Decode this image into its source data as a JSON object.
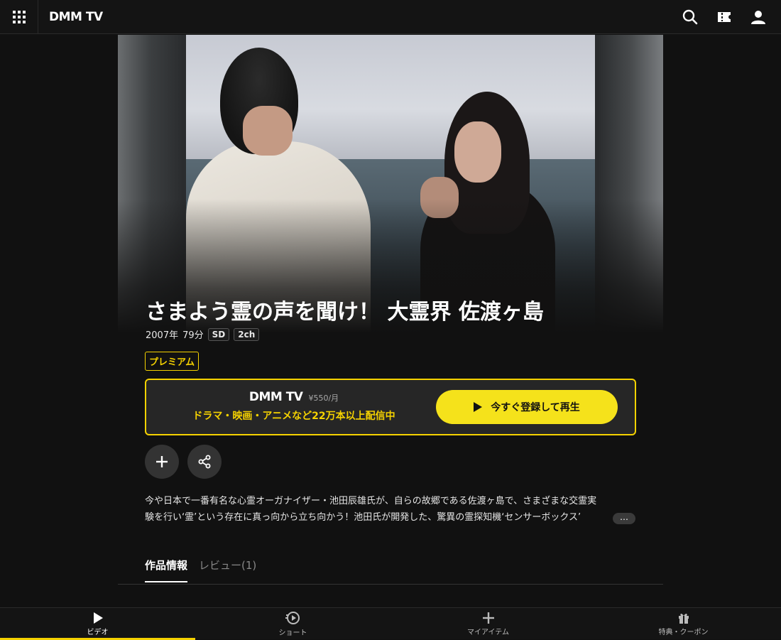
{
  "header": {
    "logo": "DMM TV",
    "icons": [
      "grid-menu-icon",
      "search-icon",
      "ticket-icon",
      "user-icon"
    ]
  },
  "video": {
    "title": "さまよう霊の声を聞け！ 大霊界 佐渡ヶ島",
    "year": "2007年",
    "duration": "79分",
    "quality": "SD",
    "audio": "2ch",
    "badge": "プレミアム"
  },
  "promo": {
    "logo": "DMM TV",
    "price": "¥550/月",
    "tagline": "ドラマ・映画・アニメなど22万本以上配信中",
    "cta_label": "今すぐ登録して再生"
  },
  "description": {
    "line1": "今や日本で一番有名な心霊オーガナイザー・池田辰雄氏が、自らの故郷である佐渡ヶ島で、さまざまな交霊実",
    "line2": "験を行い‘霊’という存在に真っ向から立ち向かう！池田氏が開発した、驚異の霊探知機‘センサーボックス’",
    "more": "…"
  },
  "tabs": [
    {
      "label": "作品情報"
    },
    {
      "label": "レビュー(1)"
    }
  ],
  "bottom_nav": [
    {
      "label": "ビデオ",
      "icon": "play-icon"
    },
    {
      "label": "ショート",
      "icon": "short-play-icon"
    },
    {
      "label": "マイアイテム",
      "icon": "plus-icon"
    },
    {
      "label": "特典・クーポン",
      "icon": "gift-icon"
    }
  ],
  "colors": {
    "accent": "#f5d200",
    "cta_bg": "#f5e21b",
    "background": "#111111"
  }
}
